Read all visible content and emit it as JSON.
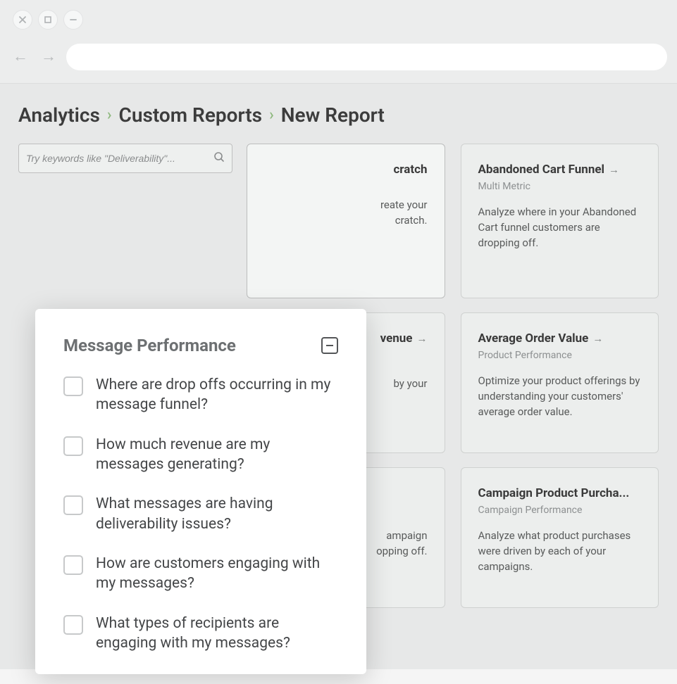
{
  "breadcrumb": {
    "items": [
      "Analytics",
      "Custom Reports",
      "New Report"
    ]
  },
  "search": {
    "placeholder": "Try keywords like \"Deliverability\"..."
  },
  "dropdown": {
    "title": "Message Performance",
    "items": [
      "Where are drop offs occurring in my message funnel?",
      "How much revenue are my messages generating?",
      "What messages are having deliverability issues?",
      "How are customers engaging with my messages?",
      "What types of recipients are engaging with my messages?"
    ]
  },
  "cards": [
    {
      "title_suffix": "cratch",
      "subtitle": "",
      "desc_suffix_line1": "reate your",
      "desc_suffix_line2": "cratch."
    },
    {
      "title": "Abandoned Cart Funnel",
      "subtitle": "Multi Metric",
      "desc": "Analyze where in your Abandoned Cart funnel customers are dropping off."
    },
    {
      "title_suffix": "venue",
      "subtitle": "",
      "desc_suffix": "by your"
    },
    {
      "title": "Average Order Value",
      "subtitle": "Product Performance",
      "desc": "Optimize your product offerings by understanding your customers' average order value."
    },
    {
      "title_suffix": "",
      "desc_suffix_line1": "ampaign",
      "desc_suffix_line2": "opping off."
    },
    {
      "title": "Campaign Product Purcha...",
      "subtitle": "Campaign Performance",
      "desc": "Analyze what product purchases were driven by each of your campaigns."
    }
  ]
}
